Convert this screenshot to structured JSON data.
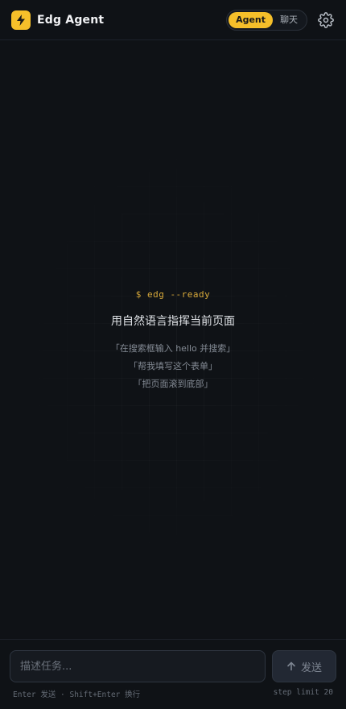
{
  "header": {
    "logo_icon": "lightning-bolt-icon",
    "title": "Edg Agent",
    "modes": [
      {
        "label": "Agent",
        "active": true
      },
      {
        "label": "聊天",
        "active": false
      }
    ],
    "settings_icon": "gear-icon"
  },
  "welcome": {
    "prompt": "$ edg --ready",
    "title": "用自然语言指挥当前页面",
    "examples": [
      "「在搜索框输入 hello 并搜索」",
      "「帮我填写这个表单」",
      "「把页面滚到底部」"
    ]
  },
  "composer": {
    "placeholder": "描述任务...",
    "value": "",
    "send_label": "发送",
    "send_icon": "arrow-up-icon",
    "hint": "Enter 发送 · Shift+Enter 换行",
    "step_limit": "step limit 20"
  },
  "colors": {
    "background": "#0f1216",
    "accent": "#f5bf2a",
    "prompt": "#d8a93a"
  }
}
